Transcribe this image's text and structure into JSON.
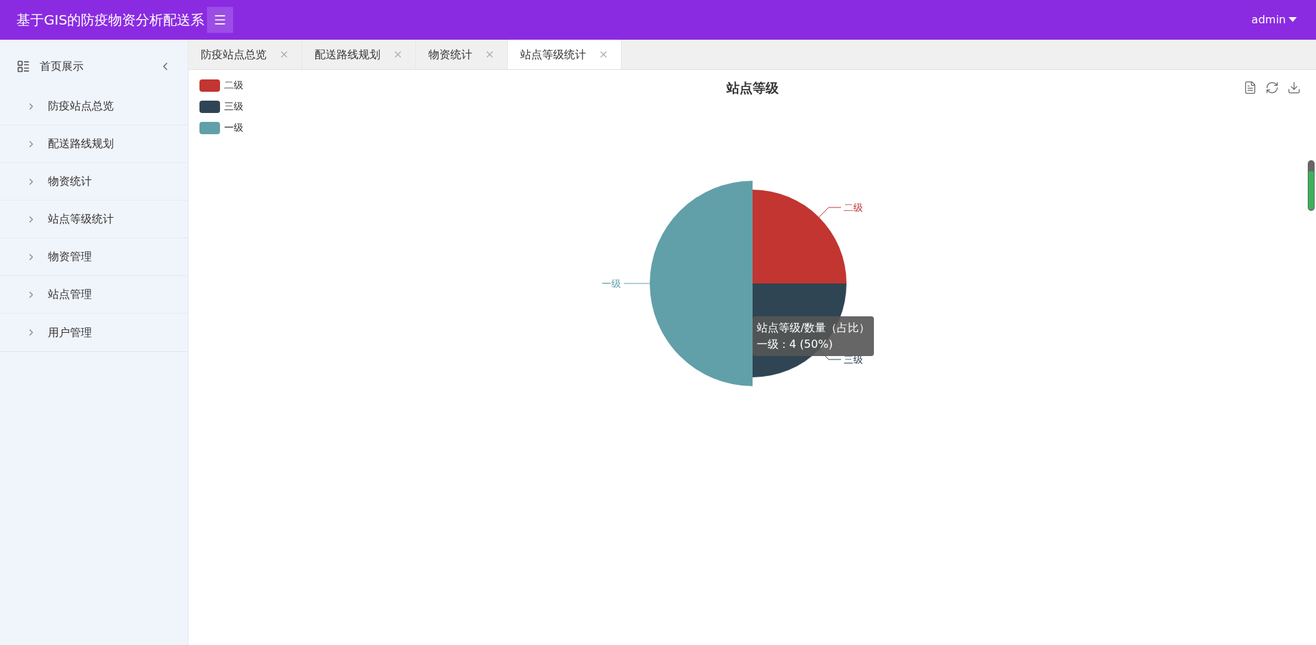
{
  "header": {
    "title": "基于GIS的防疫物资分析配送系",
    "user": "admin"
  },
  "sidebar": {
    "title": "首页展示",
    "expanded": true,
    "items": [
      {
        "label": "防疫站点总览",
        "selected": false
      },
      {
        "label": "配送路线规划",
        "selected": false
      },
      {
        "label": "物资统计",
        "selected": false
      },
      {
        "label": "站点等级统计",
        "selected": false
      },
      {
        "label": "物资管理",
        "selected": false
      },
      {
        "label": "站点管理",
        "selected": false
      },
      {
        "label": "用户管理",
        "selected": false
      }
    ]
  },
  "tabs": [
    {
      "label": "防疫站点总览",
      "selected": false
    },
    {
      "label": "配送路线规划",
      "selected": false
    },
    {
      "label": "物资统计",
      "selected": false
    },
    {
      "label": "站点等级统计",
      "selected": true
    }
  ],
  "chart": {
    "legend": [
      {
        "label": "二级",
        "color": "#c23531",
        "emphasized": false
      },
      {
        "label": "三级",
        "color": "#2f4554",
        "emphasized": false
      },
      {
        "label": "一级",
        "color": "#61a0a8",
        "emphasized": true
      }
    ],
    "chart_data": {
      "type": "pie",
      "title": "站点等级",
      "categories": [
        "二级",
        "三级",
        "一级"
      ],
      "values": [
        25,
        25,
        50
      ]
    },
    "tooltip": {
      "title": "站点等级/数量（占比）",
      "text": "一级 : 4 (50%)"
    }
  }
}
